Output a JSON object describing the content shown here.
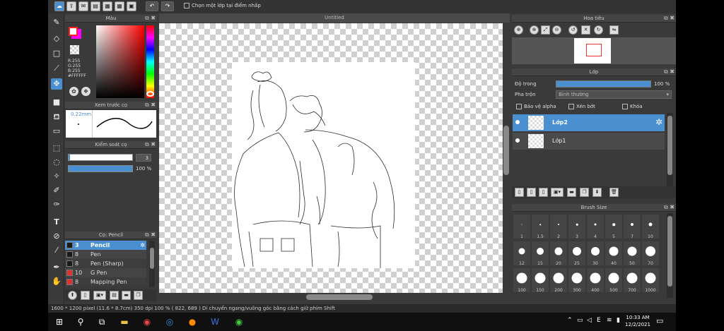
{
  "toolbar": {
    "option_label": "Chọn một lớp tại điểm nhấp"
  },
  "canvas": {
    "title": "Untitled"
  },
  "color_panel": {
    "title": "Màu",
    "r": "R:255",
    "g": "G:255",
    "b": "B:255",
    "hex": "#FFFFFF",
    "fg_color": "#ff0000",
    "bg_color": "#ff00ff"
  },
  "preview_panel": {
    "title": "Xem trước cọ",
    "size": "0.22mm"
  },
  "brush_control": {
    "title": "Kiểm soát cọ",
    "size_value": "3",
    "opacity_value": "100 %"
  },
  "brush_list": {
    "title": "Cọ: Pencil",
    "items": [
      {
        "size": "3",
        "name": "Pencil",
        "color": "#1a1a1a",
        "selected": true
      },
      {
        "size": "8",
        "name": "Pen",
        "color": "#1a1a1a"
      },
      {
        "size": "8",
        "name": "Pen (Sharp)",
        "color": "#1a1a1a"
      },
      {
        "size": "10",
        "name": "G Pen",
        "color": "#e03030"
      },
      {
        "size": "8",
        "name": "Mapping Pen",
        "color": "#e03030"
      }
    ]
  },
  "navigator": {
    "title": "Hoa tiêu"
  },
  "layer_panel": {
    "title": "Lớp",
    "opacity_label": "Độ trong",
    "opacity_value": "100 %",
    "blend_label": "Pha trộn",
    "blend_value": "Bình thường",
    "protect_alpha": "Bảo vệ alpha",
    "clipping": "Xén bớt",
    "lock": "Khóa",
    "layers": [
      {
        "name": "Lớp2",
        "selected": true
      },
      {
        "name": "Lớp1",
        "selected": false
      }
    ]
  },
  "brush_size_panel": {
    "title": "Brush Size",
    "sizes": [
      "1",
      "1.5",
      "2",
      "3",
      "4",
      "5",
      "7",
      "10",
      "12",
      "15",
      "20",
      "25",
      "30",
      "40",
      "50",
      "70",
      "100",
      "150",
      "200",
      "300",
      "400",
      "500",
      "700",
      "1000"
    ]
  },
  "status_bar": {
    "text": "1600 * 1200 pixel  (11.6 * 8.7cm)  350 dpi  100 %  ( 822, 689 )  Di chuyển ngang/vuông góc bằng cách giữ phím Shift"
  },
  "taskbar": {
    "lang": "E",
    "time": "10:33 AM",
    "date": "12/2/2021"
  }
}
